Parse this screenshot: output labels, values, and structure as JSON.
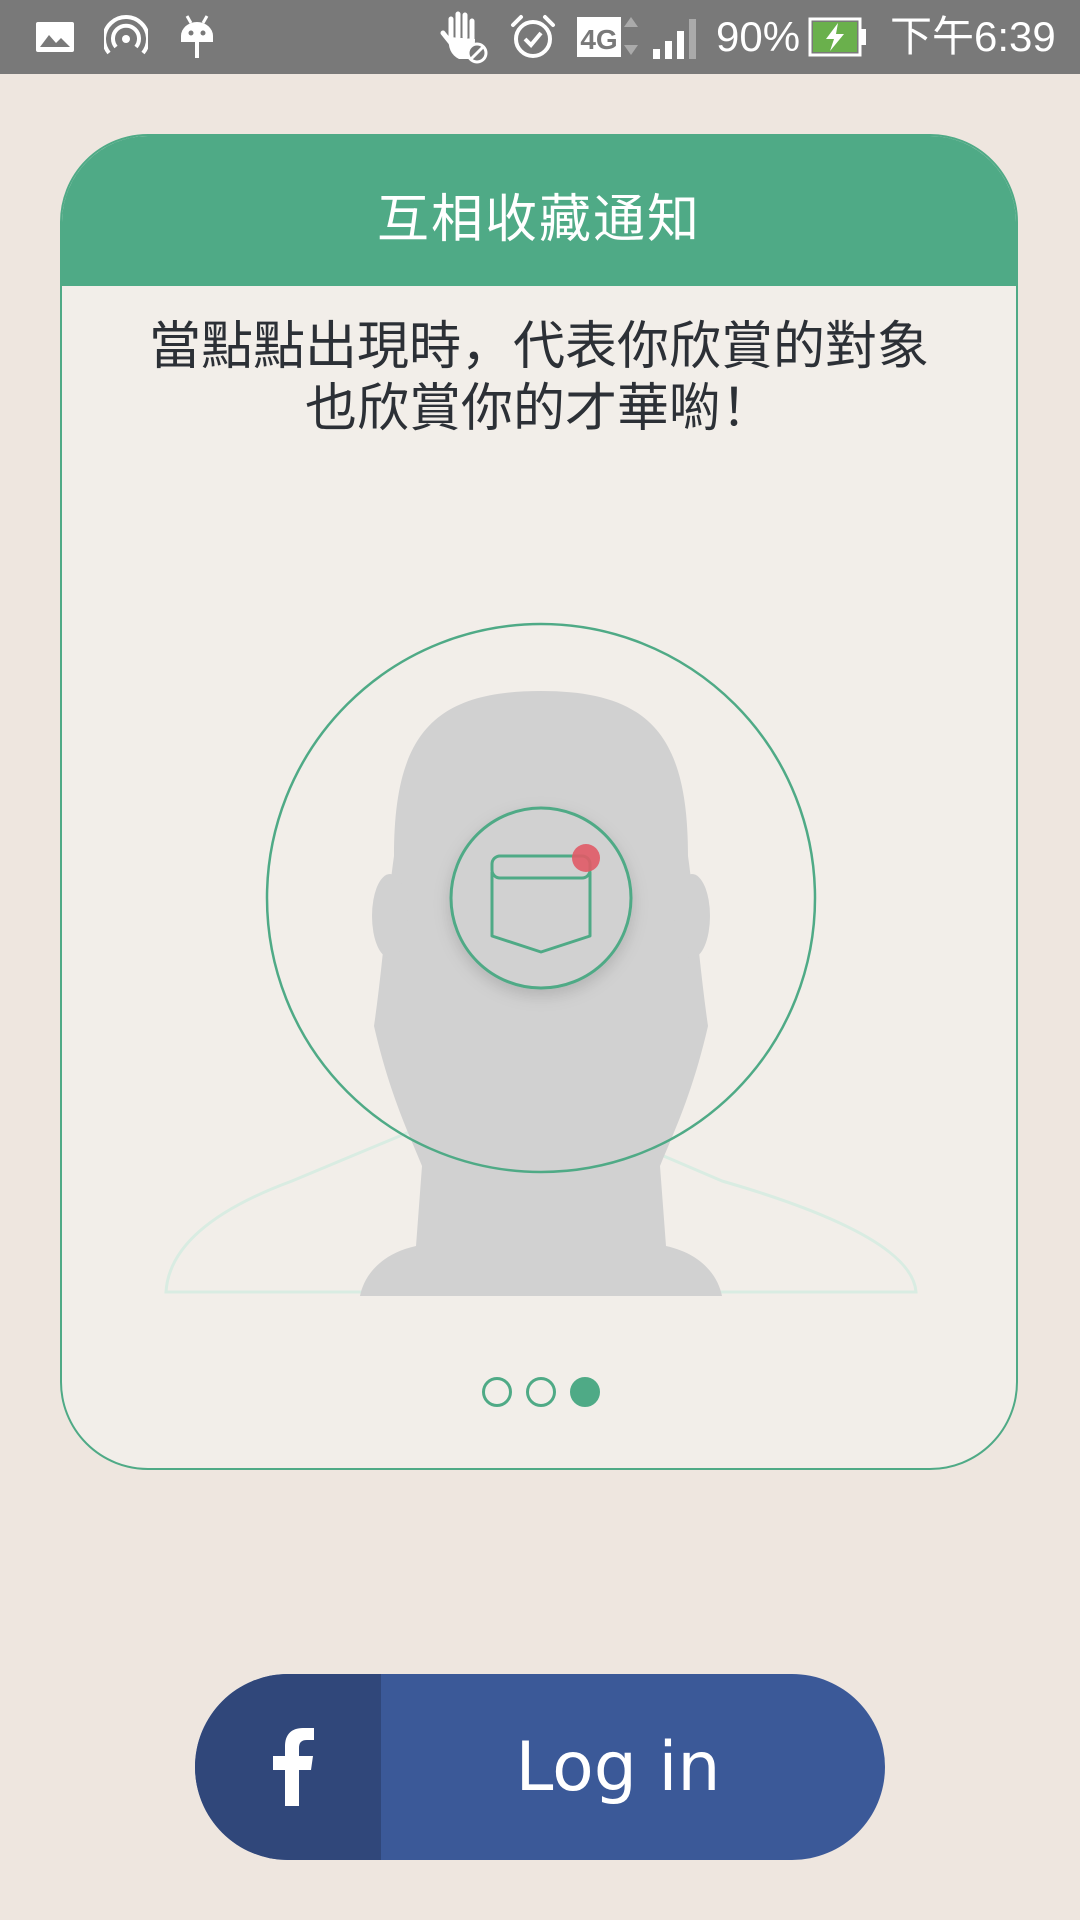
{
  "status_bar": {
    "icons_left": [
      "gallery-icon",
      "hotspot-icon",
      "android-debug-icon"
    ],
    "icons_right": [
      "do-not-disturb-hand-icon",
      "alarm-icon",
      "network-4g-icon",
      "signal-icon"
    ],
    "network_type": "4G",
    "battery_percent": "90%",
    "time": "下午6:39"
  },
  "card": {
    "title": "互相收藏通知",
    "description_line1": "當點點出現時，代表你欣賞的對象",
    "description_line2": "也欣賞你的才華喲！",
    "page_count": 3,
    "active_page": 3
  },
  "login": {
    "label": "Log in",
    "icon": "facebook-icon"
  },
  "colors": {
    "accent_green": "#4faa86",
    "facebook_blue": "#3b5998",
    "facebook_dark": "#30477a",
    "notification_red": "#e05a66",
    "background": "#eee6df"
  }
}
